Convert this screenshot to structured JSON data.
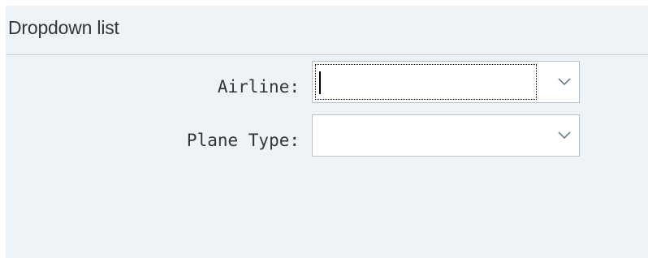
{
  "panel": {
    "title": "Dropdown list"
  },
  "fields": {
    "airline": {
      "label": "Airline:",
      "value": ""
    },
    "plane_type": {
      "label": "Plane Type:",
      "value": ""
    }
  },
  "icons": {
    "dropdown": "chevron-down-icon"
  }
}
